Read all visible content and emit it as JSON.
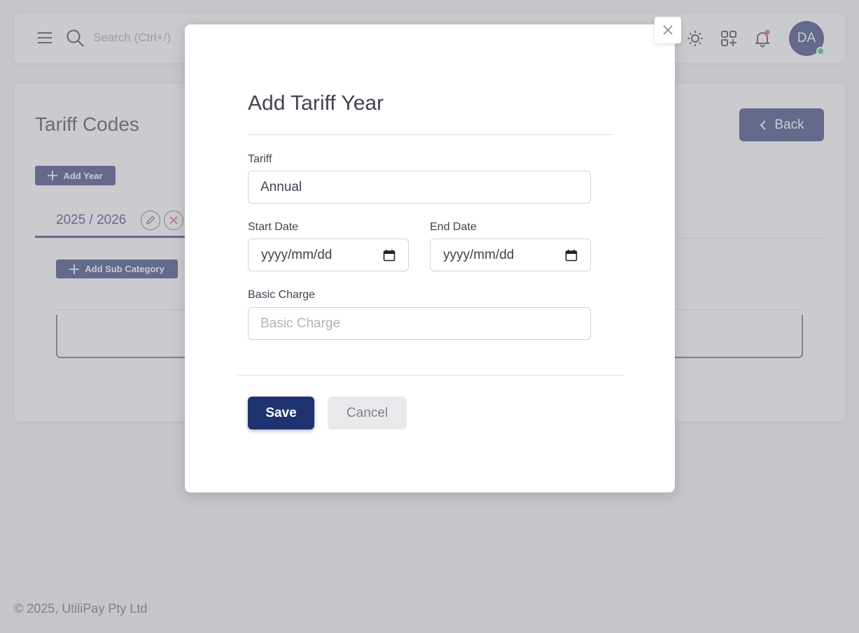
{
  "topbar": {
    "search_placeholder": "Search (Ctrl+/)",
    "avatar_initials": "DA"
  },
  "page": {
    "title": "Tariff Codes",
    "back_label": "Back",
    "add_year_label": "Add Year",
    "tab_year_label": "2025 / 2026",
    "add_sub_category_label": "Add Sub Category"
  },
  "footer": {
    "copyright": "© 2025, UtiliPay Pty Ltd"
  },
  "modal": {
    "title": "Add Tariff Year",
    "tariff_label": "Tariff",
    "tariff_value": "Annual",
    "start_date_label": "Start Date",
    "start_date_placeholder": "yyyy/mm/dd",
    "end_date_label": "End Date",
    "end_date_placeholder": "yyyy/mm/dd",
    "basic_charge_label": "Basic Charge",
    "basic_charge_placeholder": "Basic Charge",
    "save_label": "Save",
    "cancel_label": "Cancel"
  },
  "colors": {
    "primary": "#1e3370",
    "status_online": "#28c76f",
    "notification_dot": "#ff4c51",
    "delete": "#ff4c51"
  },
  "icons": {
    "menu": "menu-icon",
    "search": "search-icon",
    "theme": "sun-icon",
    "apps": "apps-icon",
    "notifications": "bell-icon",
    "close": "close-icon",
    "back": "chevron-left-icon",
    "add": "plus-icon",
    "edit": "pencil-icon",
    "delete": "x-icon",
    "calendar": "calendar-icon"
  }
}
